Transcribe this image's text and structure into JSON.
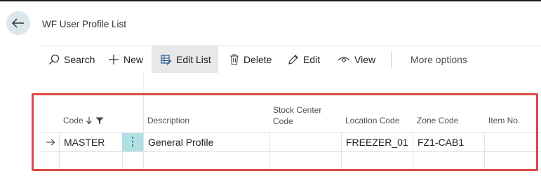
{
  "page": {
    "title": "WF User Profile List"
  },
  "actions": {
    "search": "Search",
    "new": "New",
    "edit_list": "Edit List",
    "delete": "Delete",
    "edit": "Edit",
    "view": "View",
    "more": "More options"
  },
  "table": {
    "columns": {
      "code": "Code",
      "description": "Description",
      "stock_center_line1": "Stock Center",
      "stock_center_line2": "Code",
      "location_code": "Location Code",
      "zone_code": "Zone Code",
      "item_no": "Item No."
    },
    "rows": [
      {
        "code": "MASTER",
        "description": "General Profile",
        "stock_center_code": "",
        "location_code": "FREEZER_01",
        "zone_code": "FZ1-CAB1",
        "item_no": ""
      }
    ]
  },
  "icons": {
    "back": "arrow-left-icon",
    "search": "search-icon",
    "new": "plus-icon",
    "edit_list": "edit-list-icon",
    "delete": "trash-icon",
    "edit": "pencil-icon",
    "view": "eye-icon",
    "sort": "sort-arrow-down-icon",
    "filter": "filter-icon",
    "row_indicator": "row-arrow-icon",
    "row_menu": "vertical-dots-icon"
  },
  "colors": {
    "highlight_box": "#d84a48",
    "selected_cell": "#aee0e4",
    "back_button": "#dbe7ec",
    "active_action": "#e8e8e8"
  }
}
